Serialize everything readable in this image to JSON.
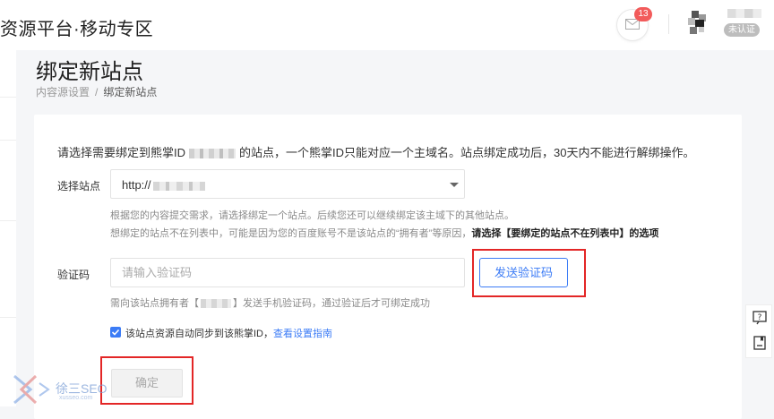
{
  "header": {
    "brand": "资源平台·移动专区",
    "notification_count": "13",
    "verify_status": "未认证"
  },
  "page": {
    "title": "绑定新站点",
    "breadcrumb": {
      "parent": "内容源设置",
      "separator": "/",
      "current": "绑定新站点"
    }
  },
  "form": {
    "intro_before": "请选择需要绑定到熊掌ID",
    "intro_after": "的站点，一个熊掌ID只能对应一个主域名。站点绑定成功后，30天内不能进行解绑操作。",
    "site": {
      "label": "选择站点",
      "value": "http://",
      "hint1": "根据您的内容提交需求，请选择绑定一个站点。后续您还可以继续绑定该主域下的其他站点。",
      "hint2_before": "想绑定的站点不在列表中，可能是因为您的百度账号不是该站点的“拥有者”等原因，",
      "hint2_bold": "请选择【要绑定的站点不在列表中】的选项"
    },
    "code": {
      "label": "验证码",
      "placeholder": "请输入验证码",
      "send_label": "发送验证码",
      "hint_before": "需向该站点拥有者【",
      "hint_after": "】发送手机验证码，通过验证后才可绑定成功"
    },
    "sync": {
      "checked": true,
      "label": "该站点资源自动同步到该熊掌ID，",
      "link": "查看设置指南"
    },
    "confirm_label": "确定"
  },
  "watermark": {
    "text": "徐三SEO",
    "sub": "xusseo.com"
  },
  "colors": {
    "accent": "#3c7cf6",
    "highlight": "#e32626",
    "badge": "#f25b5b"
  }
}
